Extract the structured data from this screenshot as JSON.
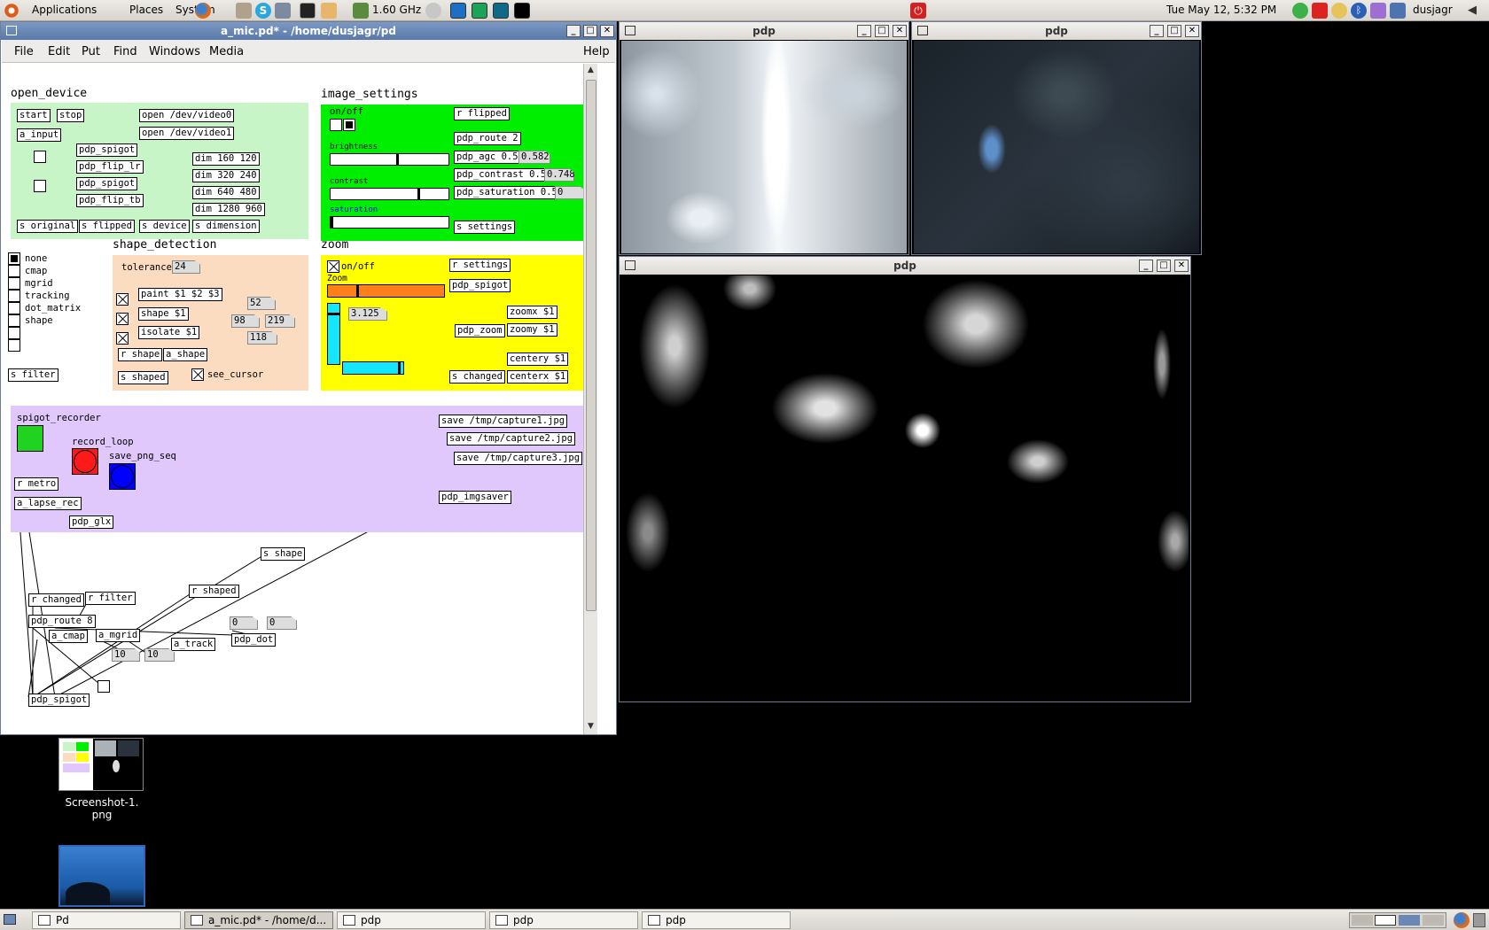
{
  "top_panel": {
    "menus": [
      "Applications",
      "Places",
      "System"
    ],
    "cpu_freq": "1.60 GHz",
    "clock": "Tue May 12,  5:32 PM",
    "user": "dusjagr"
  },
  "pd_window": {
    "title": "a_mic.pd* - /home/dusjagr/pd",
    "menus": [
      "File",
      "Edit",
      "Put",
      "Find",
      "Windows",
      "Media"
    ],
    "help": "Help",
    "sections": {
      "open_device": {
        "header": "open_device",
        "objects": {
          "start": "start",
          "stop": "stop",
          "a_input": "a_input",
          "spigot1": "pdp_spigot",
          "flip_lr": "pdp_flip_lr",
          "spigot2": "pdp_spigot",
          "flip_tb": "pdp_flip_tb",
          "video0": "open /dev/video0",
          "video1": "open /dev/video1",
          "dim1": "dim 160 120",
          "dim2": "dim 320 240",
          "dim3": "dim 640 480",
          "dim4": "dim 1280 960",
          "s_original": "s original",
          "s_flipped": "s flipped",
          "s_device": "s device",
          "s_dimension": "s dimension"
        }
      },
      "image_settings": {
        "header": "image_settings",
        "onoff": "on/off",
        "brightness": "brightness",
        "contrast": "contrast",
        "saturation": "saturation",
        "objects": {
          "r_flipped": "r flipped",
          "route": "pdp_route 2",
          "agc": "pdp_agc 0.5",
          "agc_val": "0.582",
          "contrast": "pdp_contrast 0.5",
          "contrast_val": "0.748",
          "saturation": "pdp_saturation 0.5",
          "saturation_val": "0",
          "s_settings": "s settings"
        },
        "levels": {
          "brightness": 0.57,
          "contrast": 0.75,
          "saturation": 0.0
        }
      },
      "filter_radio": {
        "options": [
          "none",
          "cmap",
          "mgrid",
          "tracking",
          "dot_matrix",
          "shape"
        ],
        "selected": "none",
        "s_filter": "s filter"
      },
      "shape_detection": {
        "header": "shape_detection",
        "tolerance": "tolerance",
        "tolerance_val": "24",
        "objects": {
          "paint": "paint $1 $2 $3",
          "shape": "shape $1",
          "isolate": "isolate $1",
          "r_shape": "r shape",
          "a_shape": "a_shape",
          "s_shaped": "s shaped",
          "n1": "52",
          "n2": "98",
          "n3": "219",
          "n4": "118"
        },
        "see_cursor": "see_cursor"
      },
      "zoom": {
        "header": "zoom",
        "onoff": "on/off",
        "zoom_label": "Zoom",
        "zoom_val": "3.125",
        "objects": {
          "r_settings": "r settings",
          "spigot": "pdp_spigot",
          "pdp_zoom": "pdp_zoom",
          "zoomx": "zoomx $1",
          "zoomy": "zoomy $1",
          "centery": "centery $1",
          "centerx": "centerx $1",
          "s_changed": "s changed"
        }
      },
      "recorder": {
        "spigot_recorder": "spigot_recorder",
        "record_loop": "record_loop",
        "save_png_seq": "save_png_seq",
        "r_metro": "r metro",
        "lapse_rec": "a_lapse_rec",
        "glx": "pdp_glx",
        "save1": "save /tmp/capture1.jpg",
        "save2": "save /tmp/capture2.jpg",
        "save3": "save /tmp/capture3.jpg",
        "imgsaver": "pdp_imgsaver",
        "colors": {
          "spigot": "#21d321",
          "record": "#ff1a1a",
          "png": "#0000ff"
        }
      },
      "bottom": {
        "s_shape": "s shape",
        "r_shaped": "r shaped",
        "r_changed": "r changed",
        "r_filter": "r filter",
        "route8": "pdp_route 8",
        "cmap": "a_cmap",
        "mgrid": "a_mgrid",
        "track": "a_track",
        "dot": "pdp_dot",
        "n10a": "10",
        "n10b": "10",
        "n0a": "0",
        "n0b": "0",
        "spigot": "pdp_spigot"
      }
    }
  },
  "video_windows": [
    {
      "title": "pdp"
    },
    {
      "title": "pdp"
    },
    {
      "title": "pdp"
    }
  ],
  "desktop": {
    "icon1_label": "Screenshot-1.\npng"
  },
  "taskbar": {
    "items": [
      "Pd",
      "a_mic.pd* - /home/d...",
      "pdp",
      "pdp",
      "pdp"
    ]
  },
  "colors": {
    "open_device_bg": "#c8f5c8",
    "image_settings_bg": "#00ee00",
    "shape_bg": "#fcdcc0",
    "zoom_bg": "#ffff00",
    "recorder_bg": "#e0c8fc",
    "slider_orange": "#ff7f1a",
    "slider_cyan": "#14e6ff"
  }
}
